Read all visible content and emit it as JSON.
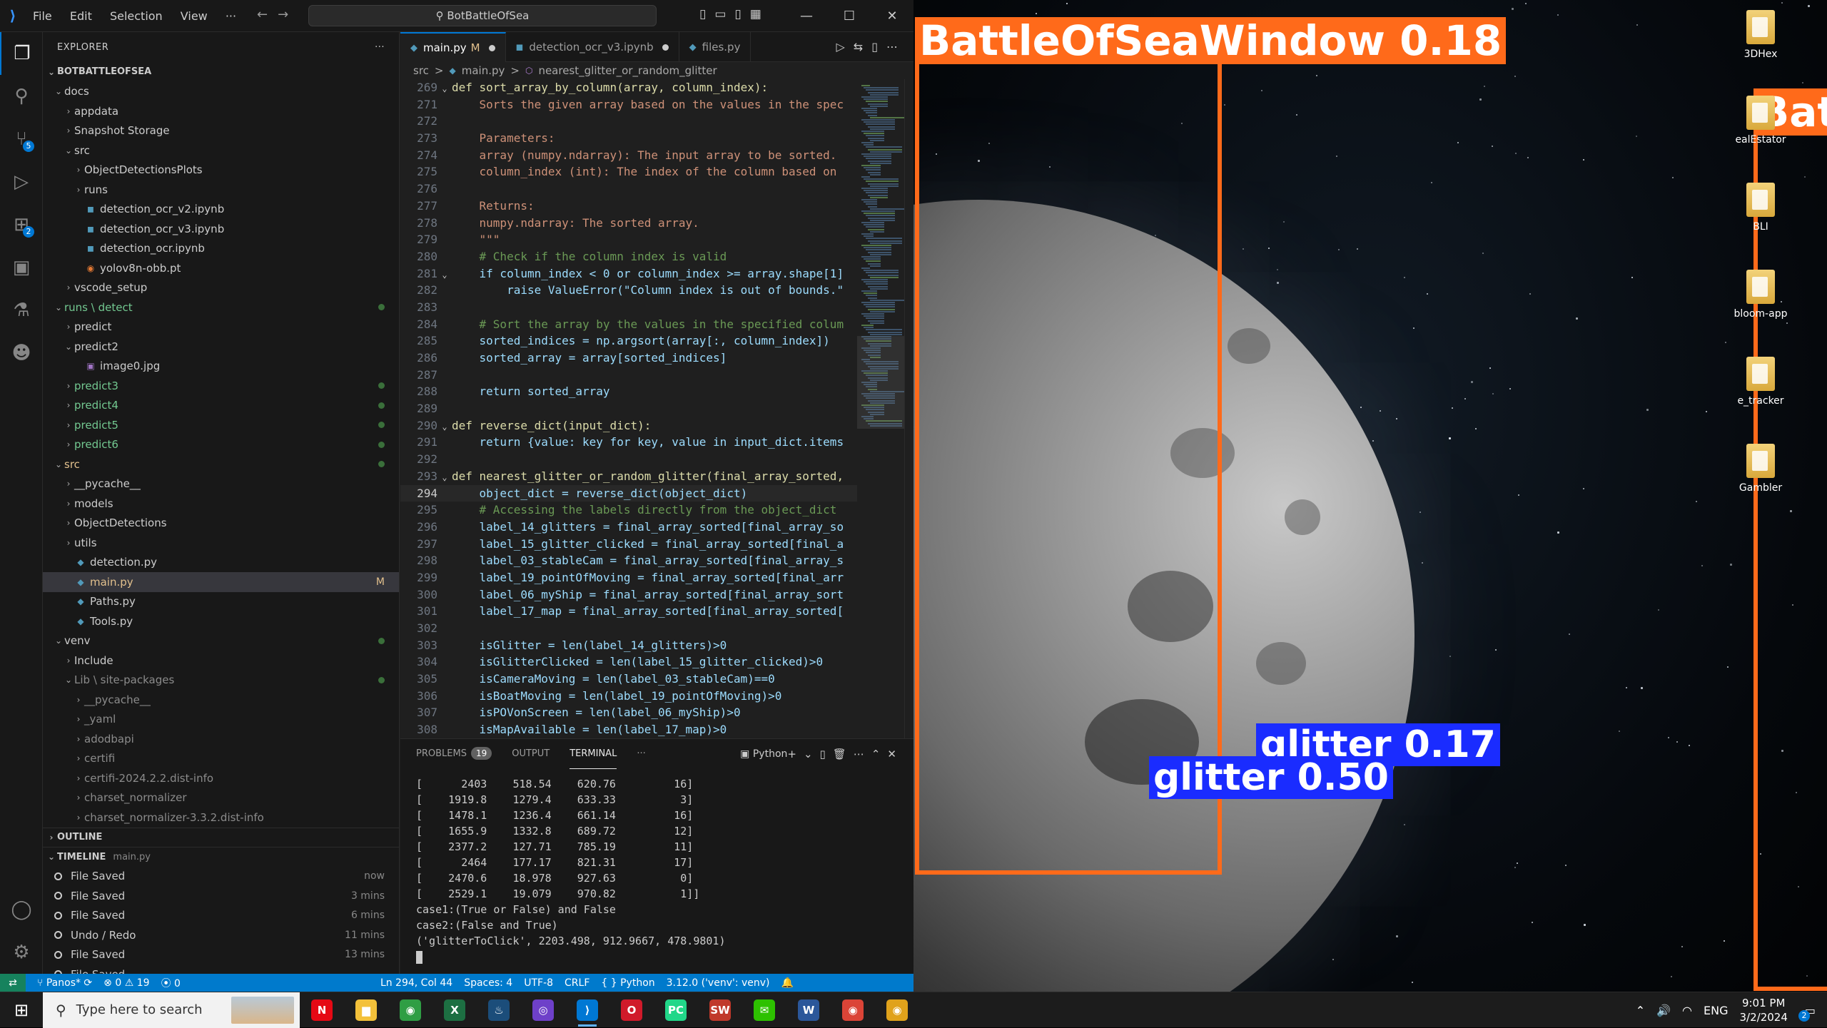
{
  "vscode": {
    "menu": [
      "File",
      "Edit",
      "Selection",
      "View",
      "···"
    ],
    "search_text": "BotBattleOfSea",
    "explorer_title": "EXPLORER",
    "explorer_more": "···",
    "project_name": "BOTBATTLEOFSEA",
    "activity_badges": {
      "source_control": "5",
      "extensions": "2"
    },
    "tree": [
      {
        "label": "docs",
        "type": "folder",
        "open": true,
        "depth": 0
      },
      {
        "label": "appdata",
        "type": "folder",
        "open": false,
        "depth": 1
      },
      {
        "label": "Snapshot Storage",
        "type": "folder",
        "open": false,
        "depth": 1
      },
      {
        "label": "src",
        "type": "folder",
        "open": true,
        "depth": 1
      },
      {
        "label": "ObjectDetectionsPlots",
        "type": "folder",
        "open": false,
        "depth": 2
      },
      {
        "label": "runs",
        "type": "folder",
        "open": false,
        "depth": 2
      },
      {
        "label": "detection_ocr_v2.ipynb",
        "type": "nb",
        "depth": 2
      },
      {
        "label": "detection_ocr_v3.ipynb",
        "type": "nb",
        "depth": 2
      },
      {
        "label": "detection_ocr.ipynb",
        "type": "nb",
        "depth": 2
      },
      {
        "label": "yolov8n-obb.pt",
        "type": "rss",
        "depth": 2
      },
      {
        "label": "vscode_setup",
        "type": "folder",
        "open": false,
        "depth": 1
      },
      {
        "label": "runs \\ detect",
        "type": "folder",
        "open": true,
        "depth": 0,
        "green": true,
        "dot": true
      },
      {
        "label": "predict",
        "type": "folder",
        "open": false,
        "depth": 1
      },
      {
        "label": "predict2",
        "type": "folder",
        "open": true,
        "depth": 1
      },
      {
        "label": "image0.jpg",
        "type": "img",
        "depth": 2
      },
      {
        "label": "predict3",
        "type": "folder",
        "open": false,
        "depth": 1,
        "green": true,
        "dot": true
      },
      {
        "label": "predict4",
        "type": "folder",
        "open": false,
        "depth": 1,
        "green": true,
        "dot": true
      },
      {
        "label": "predict5",
        "type": "folder",
        "open": false,
        "depth": 1,
        "green": true,
        "dot": true
      },
      {
        "label": "predict6",
        "type": "folder",
        "open": false,
        "depth": 1,
        "green": true,
        "dot": true
      },
      {
        "label": "src",
        "type": "folder",
        "open": true,
        "depth": 0,
        "mod": true,
        "dot": true
      },
      {
        "label": "__pycache__",
        "type": "folder",
        "open": false,
        "depth": 1
      },
      {
        "label": "models",
        "type": "folder",
        "open": false,
        "depth": 1
      },
      {
        "label": "ObjectDetections",
        "type": "folder",
        "open": false,
        "depth": 1
      },
      {
        "label": "utils",
        "type": "folder",
        "open": false,
        "depth": 1
      },
      {
        "label": "detection.py",
        "type": "py",
        "depth": 1
      },
      {
        "label": "main.py",
        "type": "py",
        "depth": 1,
        "selected": true,
        "mark": "M"
      },
      {
        "label": "Paths.py",
        "type": "py",
        "depth": 1
      },
      {
        "label": "Tools.py",
        "type": "py",
        "depth": 1
      },
      {
        "label": "venv",
        "type": "folder",
        "open": true,
        "depth": 0,
        "dot": true
      },
      {
        "label": "Include",
        "type": "folder",
        "open": false,
        "depth": 1
      },
      {
        "label": "Lib \\ site-packages",
        "type": "folder",
        "open": true,
        "depth": 1,
        "dim": true,
        "dot": true
      },
      {
        "label": "__pycache__",
        "type": "folder",
        "open": false,
        "depth": 2,
        "dim": true
      },
      {
        "label": "_yaml",
        "type": "folder",
        "open": false,
        "depth": 2,
        "dim": true
      },
      {
        "label": "adodbapi",
        "type": "folder",
        "open": false,
        "depth": 2,
        "dim": true
      },
      {
        "label": "certifi",
        "type": "folder",
        "open": false,
        "depth": 2,
        "dim": true
      },
      {
        "label": "certifi-2024.2.2.dist-info",
        "type": "folder",
        "open": false,
        "depth": 2,
        "dim": true
      },
      {
        "label": "charset_normalizer",
        "type": "folder",
        "open": false,
        "depth": 2,
        "dim": true
      },
      {
        "label": "charset_normalizer-3.3.2.dist-info",
        "type": "folder",
        "open": false,
        "depth": 2,
        "dim": true
      }
    ],
    "outline_title": "OUTLINE",
    "timeline_title": "TIMELINE",
    "timeline_file": "main.py",
    "timeline": [
      {
        "label": "File Saved",
        "when": "now"
      },
      {
        "label": "File Saved",
        "when": "3 mins"
      },
      {
        "label": "File Saved",
        "when": "6 mins"
      },
      {
        "label": "Undo / Redo",
        "when": "11 mins"
      },
      {
        "label": "File Saved",
        "when": "13 mins"
      },
      {
        "label": "File Saved",
        "when": ""
      }
    ],
    "tabs": [
      {
        "label": "main.py",
        "mod": "M",
        "active": true,
        "dot": true
      },
      {
        "label": "detection_ocr_v3.ipynb",
        "dot": true
      },
      {
        "label": "files.py"
      }
    ],
    "breadcrumb": [
      "src",
      ">",
      "main.py",
      ">",
      "nearest_glitter_or_random_glitter"
    ],
    "code": [
      {
        "n": "269",
        "t": "def sort_array_by_column(array, column_index):",
        "f": "⌄"
      },
      {
        "n": "271",
        "t": "    Sorts the given array based on the values in the spec"
      },
      {
        "n": "272",
        "t": ""
      },
      {
        "n": "273",
        "t": "    Parameters:"
      },
      {
        "n": "274",
        "t": "    array (numpy.ndarray): The input array to be sorted."
      },
      {
        "n": "275",
        "t": "    column_index (int): The index of the column based on"
      },
      {
        "n": "276",
        "t": ""
      },
      {
        "n": "277",
        "t": "    Returns:"
      },
      {
        "n": "278",
        "t": "    numpy.ndarray: The sorted array."
      },
      {
        "n": "279",
        "t": "    \"\"\""
      },
      {
        "n": "280",
        "t": "    # Check if the column index is valid"
      },
      {
        "n": "281",
        "t": "    if column_index < 0 or column_index >= array.shape[1]",
        "f": "⌄"
      },
      {
        "n": "282",
        "t": "        raise ValueError(\"Column index is out of bounds.\""
      },
      {
        "n": "283",
        "t": ""
      },
      {
        "n": "284",
        "t": "    # Sort the array by the values in the specified colum"
      },
      {
        "n": "285",
        "t": "    sorted_indices = np.argsort(array[:, column_index])"
      },
      {
        "n": "286",
        "t": "    sorted_array = array[sorted_indices]"
      },
      {
        "n": "287",
        "t": ""
      },
      {
        "n": "288",
        "t": "    return sorted_array"
      },
      {
        "n": "289",
        "t": ""
      },
      {
        "n": "290",
        "t": "def reverse_dict(input_dict):",
        "f": "⌄"
      },
      {
        "n": "291",
        "t": "    return {value: key for key, value in input_dict.items"
      },
      {
        "n": "292",
        "t": ""
      },
      {
        "n": "293",
        "t": "def nearest_glitter_or_random_glitter(final_array_sorted,",
        "f": "⌄"
      },
      {
        "n": "294",
        "t": "    object_dict = reverse_dict(object_dict)",
        "cur": true
      },
      {
        "n": "295",
        "t": "    # Accessing the labels directly from the object_dict"
      },
      {
        "n": "296",
        "t": "    label_14_glitters = final_array_sorted[final_array_so"
      },
      {
        "n": "297",
        "t": "    label_15_glitter_clicked = final_array_sorted[final_a"
      },
      {
        "n": "298",
        "t": "    label_03_stableCam = final_array_sorted[final_array_s"
      },
      {
        "n": "299",
        "t": "    label_19_pointOfMoving = final_array_sorted[final_arr"
      },
      {
        "n": "300",
        "t": "    label_06_myShip = final_array_sorted[final_array_sort"
      },
      {
        "n": "301",
        "t": "    label_17_map = final_array_sorted[final_array_sorted["
      },
      {
        "n": "302",
        "t": ""
      },
      {
        "n": "303",
        "t": "    isGlitter = len(label_14_glitters)>0"
      },
      {
        "n": "304",
        "t": "    isGlitterClicked = len(label_15_glitter_clicked)>0"
      },
      {
        "n": "305",
        "t": "    isCameraMoving = len(label_03_stableCam)==0"
      },
      {
        "n": "306",
        "t": "    isBoatMoving = len(label_19_pointOfMoving)>0"
      },
      {
        "n": "307",
        "t": "    isPOVonScreen = len(label_06_myShip)>0"
      },
      {
        "n": "308",
        "t": "    isMapAvailable = len(label_17_map)>0"
      }
    ],
    "panel_tabs": [
      {
        "label": "PROBLEMS",
        "count": "19"
      },
      {
        "label": "OUTPUT"
      },
      {
        "label": "TERMINAL",
        "active": true
      },
      {
        "label": "···"
      }
    ],
    "terminal_shell": "Python",
    "terminal": [
      "[      2403    518.54    620.76         16]",
      "[    1919.8    1279.4    633.33          3]",
      "[    1478.1    1236.4    661.14         16]",
      "[    1655.9    1332.8    689.72         12]",
      "[    2377.2    127.71    785.19         11]",
      "[      2464    177.17    821.31         17]",
      "[    2470.6    18.978    927.63          0]",
      "[    2529.1    19.079    970.82          1]]",
      "case1:(True or False) and False",
      "case2:(False and True)",
      "('glitterToClick', 2203.498, 912.9667, 478.9801)"
    ],
    "status": {
      "branch": "Panos*",
      "errors": "0",
      "warnings": "19",
      "ports": "0",
      "position": "Ln 294, Col 44",
      "spaces": "Spaces: 4",
      "encoding": "UTF-8",
      "eol": "CRLF",
      "language": "Python",
      "interpreter": "3.12.0 ('venv': venv)"
    }
  },
  "detections": [
    {
      "label": "BattleOfSeaWindow 0.18",
      "color": "#ff6a1a"
    },
    {
      "label": "Bat",
      "color": "#ff6a1a"
    },
    {
      "label": "glitter 0.17",
      "color": "#1a2cff"
    },
    {
      "label": "glitter 0.50",
      "color": "#1a2cff"
    }
  ],
  "desktop_icons": [
    "3DHex",
    "ealEstator",
    "BLI",
    "bloom-app",
    "e_tracker",
    "Gambler"
  ],
  "taskbar": {
    "search_placeholder": "Type here to search",
    "apps": [
      {
        "name": "netflix",
        "glyph": "N",
        "color": "#e50914"
      },
      {
        "name": "explorer",
        "glyph": "▆",
        "color": "#f3c13a"
      },
      {
        "name": "chrome",
        "glyph": "◉",
        "color": "#2f9e44"
      },
      {
        "name": "excel",
        "glyph": "X",
        "color": "#1d6f42"
      },
      {
        "name": "steam",
        "glyph": "♨",
        "color": "#1b4d7a"
      },
      {
        "name": "github",
        "glyph": "◎",
        "color": "#6e40c9"
      },
      {
        "name": "vscode",
        "glyph": "⟩",
        "color": "#0078d4",
        "active": true
      },
      {
        "name": "opera",
        "glyph": "O",
        "color": "#d01a2a"
      },
      {
        "name": "pycharm",
        "glyph": "PC",
        "color": "#21d789"
      },
      {
        "name": "seawar",
        "glyph": "SW",
        "color": "#c0392b"
      },
      {
        "name": "wechat",
        "glyph": "✉",
        "color": "#2dc100"
      },
      {
        "name": "word",
        "glyph": "W",
        "color": "#2b579a"
      },
      {
        "name": "chrome2",
        "glyph": "◉",
        "color": "#db4437"
      },
      {
        "name": "chrome3",
        "glyph": "◉",
        "color": "#e0a21b"
      }
    ],
    "language": "ENG",
    "time": "9:01 PM",
    "date": "3/2/2024",
    "notifications": "2"
  }
}
